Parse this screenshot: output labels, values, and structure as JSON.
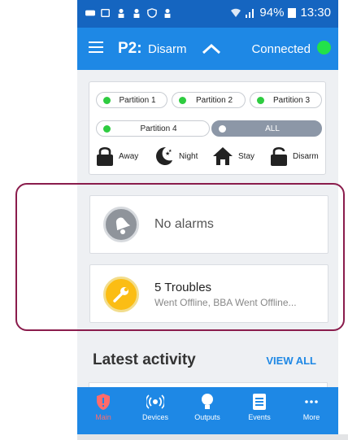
{
  "status_bar": {
    "battery": "94%",
    "time": "13:30"
  },
  "app_bar": {
    "partition": "P2:",
    "state": "Disarm",
    "connection": "Connected",
    "connection_color": "#22e14a"
  },
  "partitions": {
    "items": [
      {
        "label": "Partition 1"
      },
      {
        "label": "Partition 2"
      },
      {
        "label": "Partition 3"
      },
      {
        "label": "Partition 4"
      },
      {
        "label": "ALL"
      }
    ],
    "modes": [
      {
        "label": "Away",
        "icon": "lock-icon"
      },
      {
        "label": "Night",
        "icon": "moon-stars-icon"
      },
      {
        "label": "Stay",
        "icon": "home-icon"
      },
      {
        "label": "Disarm",
        "icon": "unlock-icon"
      }
    ]
  },
  "alarm": {
    "text": "No alarms",
    "icon": "bell-icon"
  },
  "troubles": {
    "title": "5 Troubles",
    "subtitle": "Went Offline, BBA Went Offline...",
    "icon": "wrench-icon",
    "color": "#fbbd14"
  },
  "activity": {
    "title": "Latest activity",
    "view_all": "VIEW ALL"
  },
  "bottom_nav": {
    "items": [
      {
        "label": "Main",
        "icon": "shield-icon",
        "active": true
      },
      {
        "label": "Devices",
        "icon": "sensor-icon"
      },
      {
        "label": "Outputs",
        "icon": "bulb-icon"
      },
      {
        "label": "Events",
        "icon": "list-icon"
      },
      {
        "label": "More",
        "icon": "more-icon"
      }
    ]
  },
  "colors": {
    "primary": "#1e88e5",
    "status_bar": "#1565c0",
    "accent_active": "#ff6b6b",
    "highlight": "#8a1c4c"
  }
}
